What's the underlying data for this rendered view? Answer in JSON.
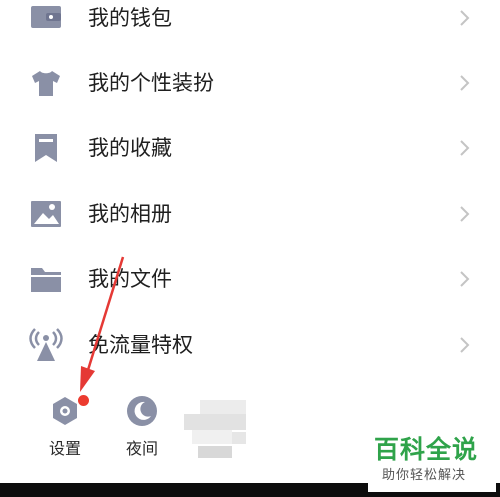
{
  "menu": {
    "items": [
      {
        "label": "我的钱包",
        "icon": "wallet-icon"
      },
      {
        "label": "我的个性装扮",
        "icon": "tshirt-icon"
      },
      {
        "label": "我的收藏",
        "icon": "bookmark-icon"
      },
      {
        "label": "我的相册",
        "icon": "photo-icon"
      },
      {
        "label": "我的文件",
        "icon": "folder-icon"
      },
      {
        "label": "免流量特权",
        "icon": "signal-tower-icon"
      }
    ]
  },
  "bottom_bar": {
    "settings_label": "设置",
    "night_label": "夜间"
  },
  "watermark": {
    "title": "百科全说",
    "subtitle": "助你轻松解决"
  },
  "colors": {
    "icon": "#8a90a6",
    "text": "#1f1f1f",
    "chevron": "#c4c4c4",
    "red_dot": "#ec3b2f",
    "arrow": "#e53935",
    "watermark": "#2fa34a"
  }
}
